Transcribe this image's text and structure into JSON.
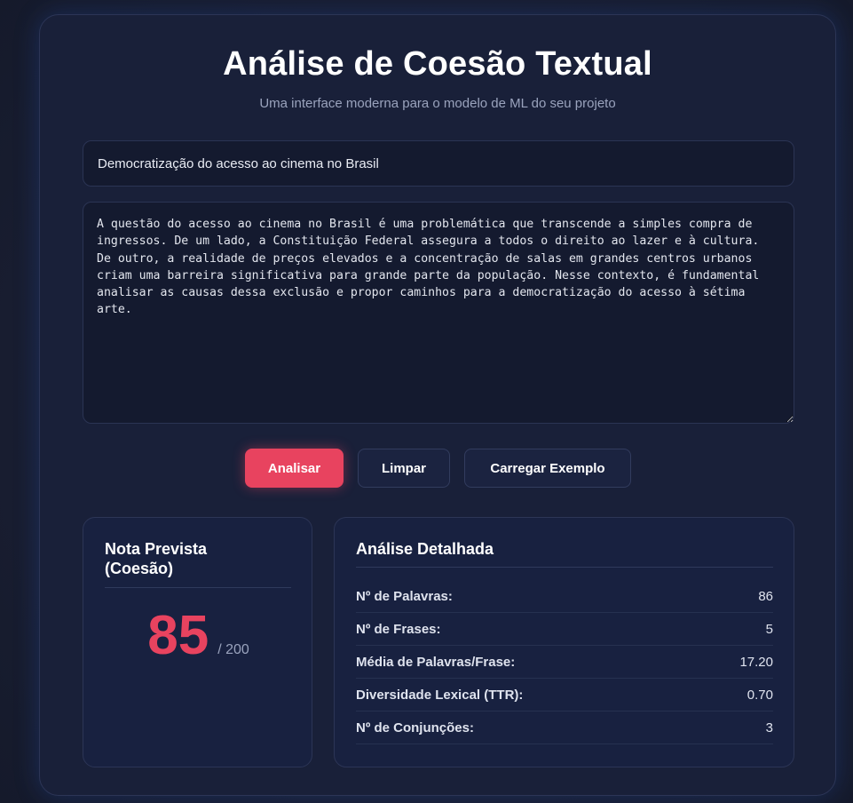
{
  "header": {
    "title": "Análise de Coesão Textual",
    "subtitle": "Uma interface moderna para o modelo de ML do seu projeto"
  },
  "form": {
    "title_value": "Democratização do acesso ao cinema no Brasil",
    "essay_value": "A questão do acesso ao cinema no Brasil é uma problemática que transcende a simples compra de ingressos. De um lado, a Constituição Federal assegura a todos o direito ao lazer e à cultura. De outro, a realidade de preços elevados e a concentração de salas em grandes centros urbanos criam uma barreira significativa para grande parte da população. Nesse contexto, é fundamental analisar as causas dessa exclusão e propor caminhos para a democratização do acesso à sétima arte."
  },
  "buttons": {
    "analyze": "Analisar",
    "clear": "Limpar",
    "load_example": "Carregar Exemplo"
  },
  "score": {
    "heading": "Nota Prevista (Coesão)",
    "value": "85",
    "max": "/ 200"
  },
  "details": {
    "heading": "Análise Detalhada",
    "rows": [
      {
        "label": "Nº de Palavras:",
        "value": "86"
      },
      {
        "label": "Nº de Frases:",
        "value": "5"
      },
      {
        "label": "Média de Palavras/Frase:",
        "value": "17.20"
      },
      {
        "label": "Diversidade Lexical (TTR):",
        "value": "0.70"
      },
      {
        "label": "Nº de Conjunções:",
        "value": "3"
      }
    ]
  },
  "colors": {
    "accent": "#e8435f",
    "background": "#192039",
    "panel": "#182140"
  }
}
